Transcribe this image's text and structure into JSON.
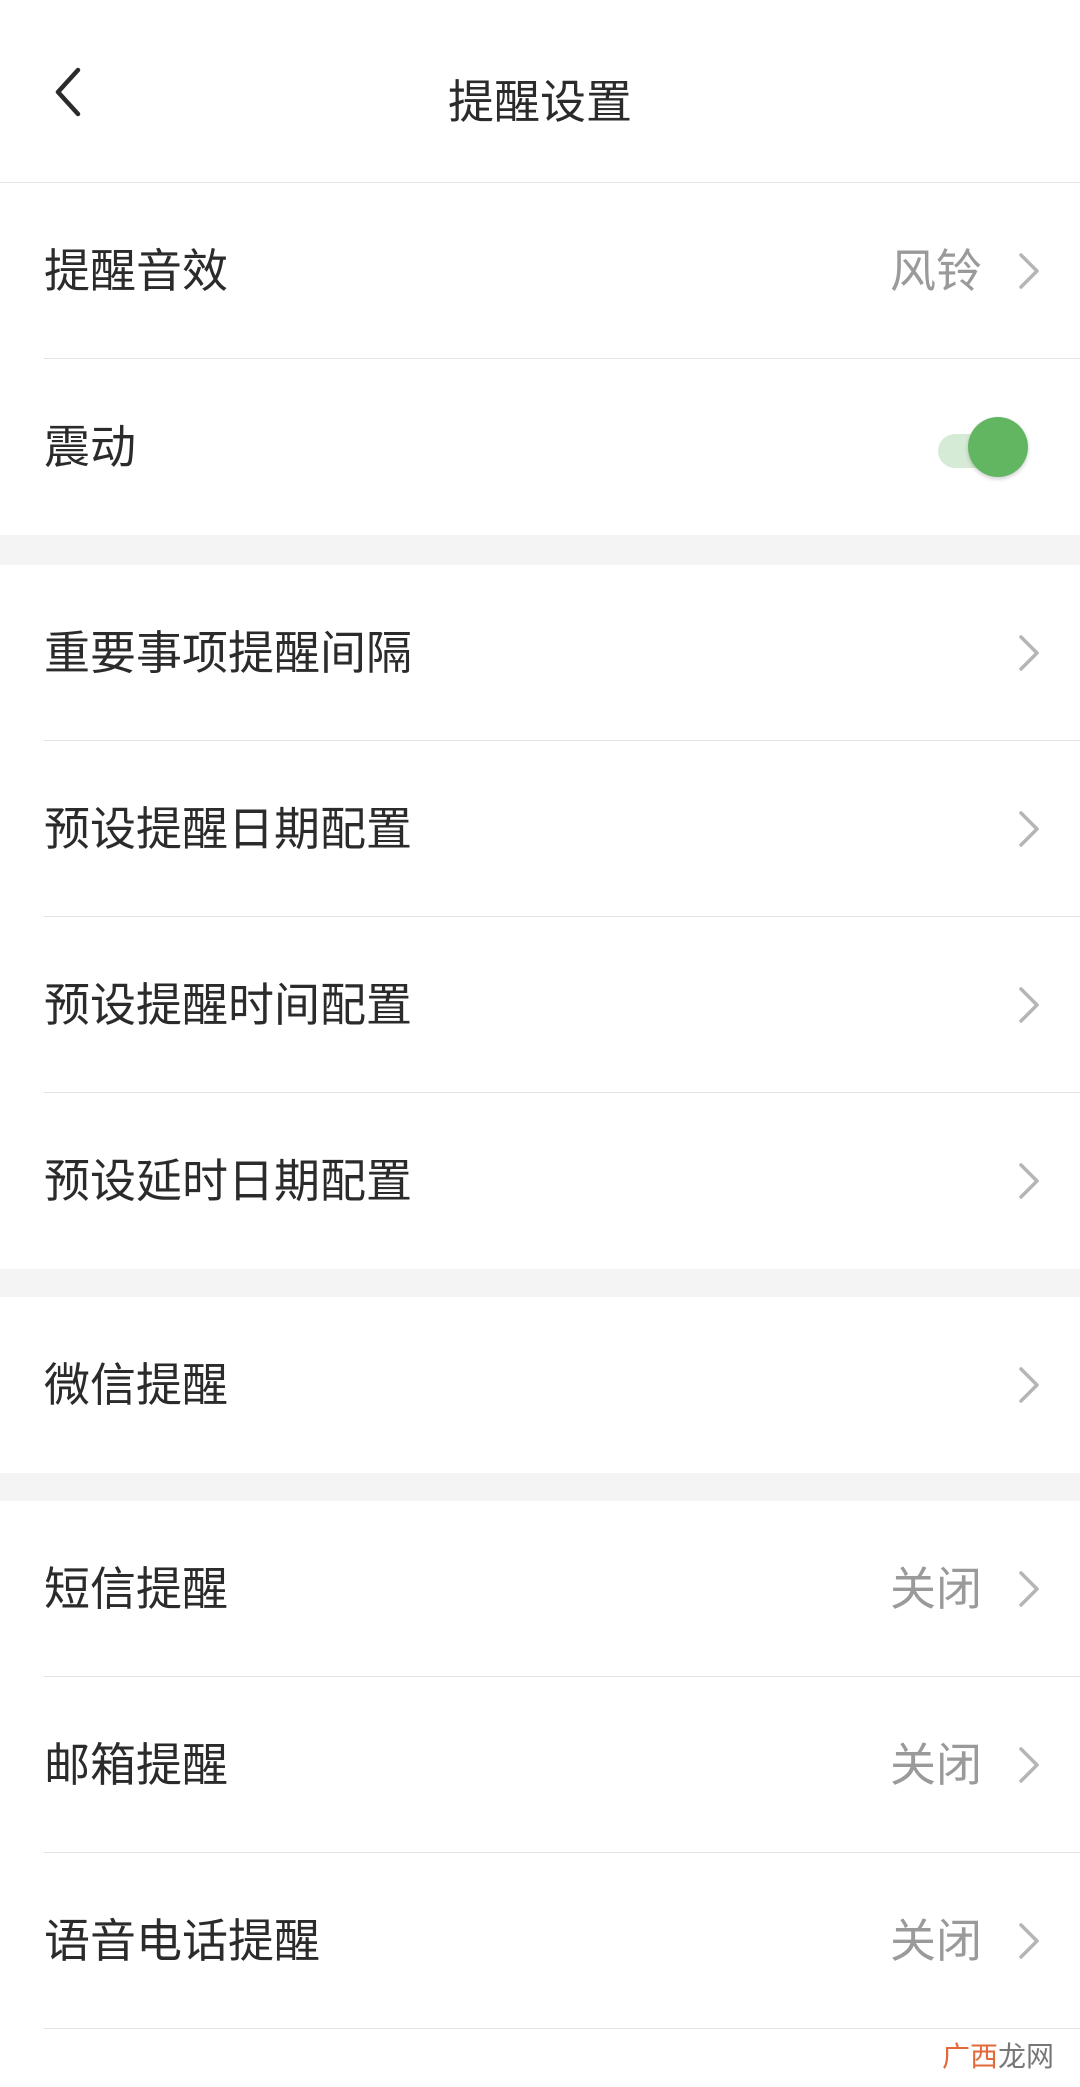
{
  "header": {
    "title": "提醒设置"
  },
  "colors": {
    "toggle_on": "#62b662",
    "value_text": "#9a9a9a",
    "section_gap": "#f4f4f4"
  },
  "settings": {
    "sound": {
      "label": "提醒音效",
      "value": "风铃"
    },
    "vibration": {
      "label": "震动",
      "enabled": true
    },
    "important_interval": {
      "label": "重要事项提醒间隔"
    },
    "preset_date": {
      "label": "预设提醒日期配置"
    },
    "preset_time": {
      "label": "预设提醒时间配置"
    },
    "preset_delay": {
      "label": "预设延时日期配置"
    },
    "wechat": {
      "label": "微信提醒"
    },
    "sms": {
      "label": "短信提醒",
      "value": "关闭"
    },
    "email": {
      "label": "邮箱提醒",
      "value": "关闭"
    },
    "voice_call": {
      "label": "语音电话提醒",
      "value": "关闭"
    }
  },
  "watermark": {
    "part1": "广西",
    "part2": "龙网"
  }
}
